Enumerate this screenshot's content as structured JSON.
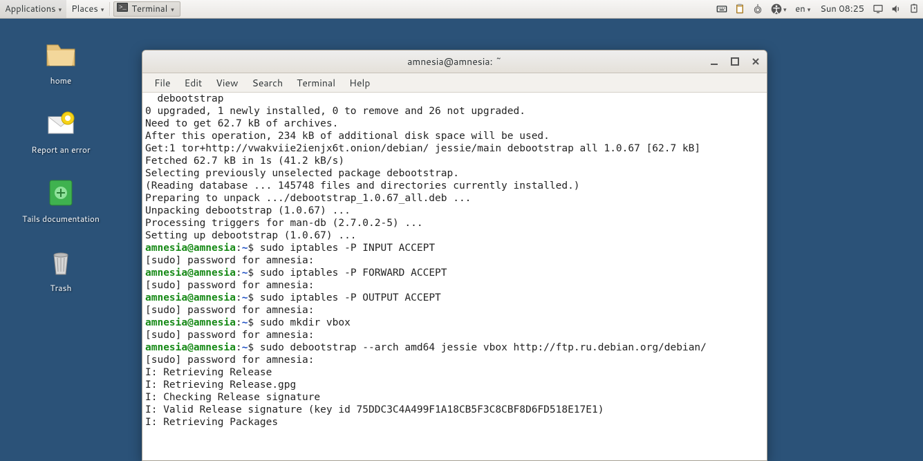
{
  "panel": {
    "applications": "Applications",
    "places": "Places",
    "task_terminal": "Terminal",
    "lang": "en",
    "clock": "Sun 08:25"
  },
  "desktop_icons": {
    "home": "home",
    "report": "Report an error",
    "docs": "Tails documentation",
    "trash": "Trash"
  },
  "window": {
    "title": "amnesia@amnesia: ~",
    "menus": {
      "file": "File",
      "edit": "Edit",
      "view": "View",
      "search": "Search",
      "terminal": "Terminal",
      "help": "Help"
    }
  },
  "prompt": {
    "userhost": "amnesia@amnesia",
    "path": "~",
    "sep": ":",
    "end": "$ "
  },
  "terminal_lines": [
    {
      "t": "plain",
      "text": "  debootstrap"
    },
    {
      "t": "plain",
      "text": "0 upgraded, 1 newly installed, 0 to remove and 26 not upgraded."
    },
    {
      "t": "plain",
      "text": "Need to get 62.7 kB of archives."
    },
    {
      "t": "plain",
      "text": "After this operation, 234 kB of additional disk space will be used."
    },
    {
      "t": "plain",
      "text": "Get:1 tor+http://vwakviie2ienjx6t.onion/debian/ jessie/main debootstrap all 1.0.67 [62.7 kB]"
    },
    {
      "t": "plain",
      "text": "Fetched 62.7 kB in 1s (41.2 kB/s)"
    },
    {
      "t": "plain",
      "text": "Selecting previously unselected package debootstrap."
    },
    {
      "t": "plain",
      "text": "(Reading database ... 145748 files and directories currently installed.)"
    },
    {
      "t": "plain",
      "text": "Preparing to unpack .../debootstrap_1.0.67_all.deb ..."
    },
    {
      "t": "plain",
      "text": "Unpacking debootstrap (1.0.67) ..."
    },
    {
      "t": "plain",
      "text": "Processing triggers for man-db (2.7.0.2-5) ..."
    },
    {
      "t": "plain",
      "text": "Setting up debootstrap (1.0.67) ..."
    },
    {
      "t": "prompt",
      "cmd": "sudo iptables -P INPUT ACCEPT"
    },
    {
      "t": "plain",
      "text": "[sudo] password for amnesia:"
    },
    {
      "t": "prompt",
      "cmd": "sudo iptables -P FORWARD ACCEPT"
    },
    {
      "t": "plain",
      "text": "[sudo] password for amnesia:"
    },
    {
      "t": "prompt",
      "cmd": "sudo iptables -P OUTPUT ACCEPT"
    },
    {
      "t": "plain",
      "text": "[sudo] password for amnesia:"
    },
    {
      "t": "prompt",
      "cmd": "sudo mkdir vbox"
    },
    {
      "t": "plain",
      "text": "[sudo] password for amnesia:"
    },
    {
      "t": "prompt",
      "cmd": "sudo debootstrap --arch amd64 jessie vbox http://ftp.ru.debian.org/debian/"
    },
    {
      "t": "plain",
      "text": "[sudo] password for amnesia:"
    },
    {
      "t": "plain",
      "text": "I: Retrieving Release"
    },
    {
      "t": "plain",
      "text": "I: Retrieving Release.gpg"
    },
    {
      "t": "plain",
      "text": "I: Checking Release signature"
    },
    {
      "t": "plain",
      "text": "I: Valid Release signature (key id 75DDC3C4A499F1A18CB5F3C8CBF8D6FD518E17E1)"
    },
    {
      "t": "plain",
      "text": "I: Retrieving Packages"
    }
  ]
}
